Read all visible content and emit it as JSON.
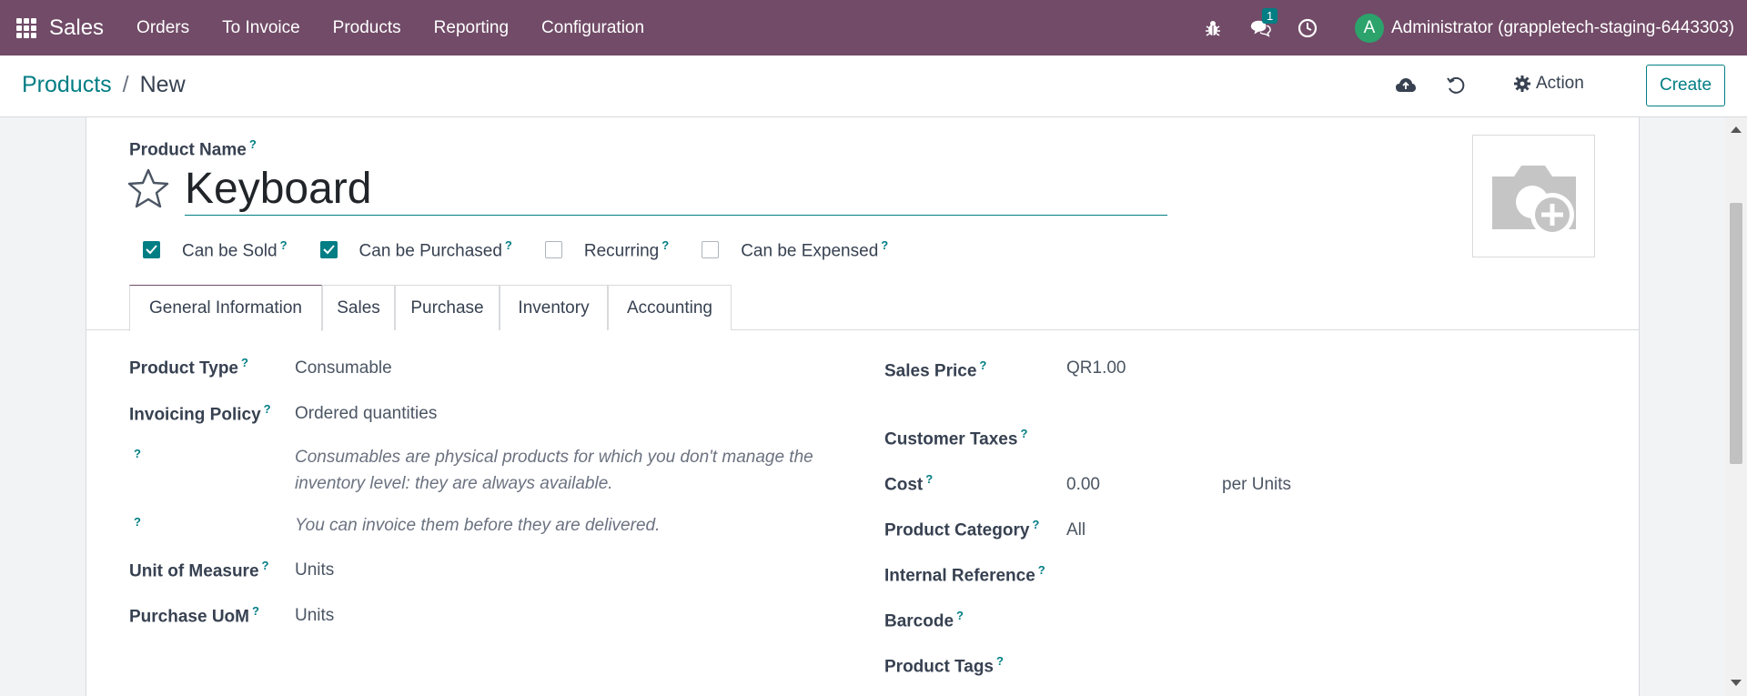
{
  "navbar": {
    "app_name": "Sales",
    "menu": [
      "Orders",
      "To Invoice",
      "Products",
      "Reporting",
      "Configuration"
    ],
    "messages_badge": "1",
    "avatar_letter": "A",
    "user_name": "Administrator (grappletech-staging-6443303)"
  },
  "breadcrumb": {
    "parent": "Products",
    "separator": "/",
    "current": "New"
  },
  "control_panel": {
    "action_label": "Action",
    "create_label": "Create"
  },
  "form": {
    "product_name_label": "Product Name",
    "product_name_value": "Keyboard",
    "help_mark": "?",
    "checkboxes": [
      {
        "label": "Can be Sold",
        "checked": true
      },
      {
        "label": "Can be Purchased",
        "checked": true
      },
      {
        "label": "Recurring",
        "checked": false
      },
      {
        "label": "Can be Expensed",
        "checked": false
      }
    ],
    "tabs": [
      "General Information",
      "Sales",
      "Purchase",
      "Inventory",
      "Accounting"
    ],
    "left_fields": {
      "product_type_label": "Product Type",
      "product_type_value": "Consumable",
      "invoicing_policy_label": "Invoicing Policy",
      "invoicing_policy_value": "Ordered quantities",
      "help_consumable_line1": "Consumables are physical products for which you don't manage the",
      "help_consumable_line2": "inventory level: they are always available.",
      "help_invoice": "You can invoice them before they are delivered.",
      "uom_label": "Unit of Measure",
      "uom_value": "Units",
      "purchase_uom_label": "Purchase UoM",
      "purchase_uom_value": "Units"
    },
    "right_fields": {
      "sales_price_label": "Sales Price",
      "sales_price_value": "QR1.00",
      "customer_taxes_label": "Customer Taxes",
      "cost_label": "Cost",
      "cost_value": "0.00",
      "cost_unit": "per Units",
      "category_label": "Product Category",
      "category_value": "All",
      "internal_ref_label": "Internal Reference",
      "barcode_label": "Barcode",
      "tags_label": "Product Tags"
    }
  },
  "colors": {
    "navbar": "#714b67",
    "accent": "#017e84",
    "avatar": "#2ca36b"
  }
}
